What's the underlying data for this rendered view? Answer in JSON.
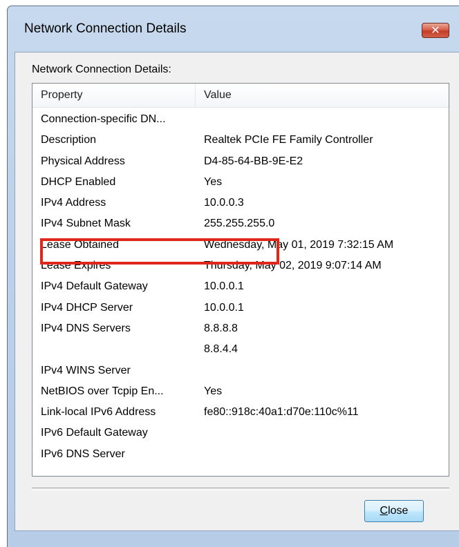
{
  "window": {
    "title": "Network Connection Details",
    "close_glyph": "✕"
  },
  "group_label": "Network Connection Details:",
  "table": {
    "columns": [
      "Property",
      "Value"
    ],
    "rows": [
      {
        "property": "Connection-specific DN...",
        "value": ""
      },
      {
        "property": "Description",
        "value": "Realtek PCIe FE Family Controller"
      },
      {
        "property": "Physical Address",
        "value": "D4-85-64-BB-9E-E2"
      },
      {
        "property": "DHCP Enabled",
        "value": "Yes"
      },
      {
        "property": "IPv4 Address",
        "value": "10.0.0.3"
      },
      {
        "property": "IPv4 Subnet Mask",
        "value": "255.255.255.0"
      },
      {
        "property": "Lease Obtained",
        "value": "Wednesday, May 01, 2019 7:32:15 AM"
      },
      {
        "property": "Lease Expires",
        "value": "Thursday, May 02, 2019 9:07:14 AM"
      },
      {
        "property": "IPv4 Default Gateway",
        "value": "10.0.0.1"
      },
      {
        "property": "IPv4 DHCP Server",
        "value": "10.0.0.1"
      },
      {
        "property": "IPv4 DNS Servers",
        "value": "8.8.8.8"
      },
      {
        "property": "",
        "value": "8.8.4.4"
      },
      {
        "property": "IPv4 WINS Server",
        "value": ""
      },
      {
        "property": "NetBIOS over Tcpip En...",
        "value": "Yes"
      },
      {
        "property": "Link-local IPv6 Address",
        "value": "fe80::918c:40a1:d70e:110c%11"
      },
      {
        "property": "IPv6 Default Gateway",
        "value": ""
      },
      {
        "property": "IPv6 DNS Server",
        "value": ""
      }
    ]
  },
  "highlight": {
    "row_property": "IPv4 Address",
    "color": "#e0271c"
  },
  "buttons": {
    "close_accel": "C",
    "close_rest": "lose"
  },
  "colors": {
    "titlebar": "#c7d9ee",
    "close_button_red": "#c23d27",
    "dialog_bg": "#f0f0f0"
  }
}
